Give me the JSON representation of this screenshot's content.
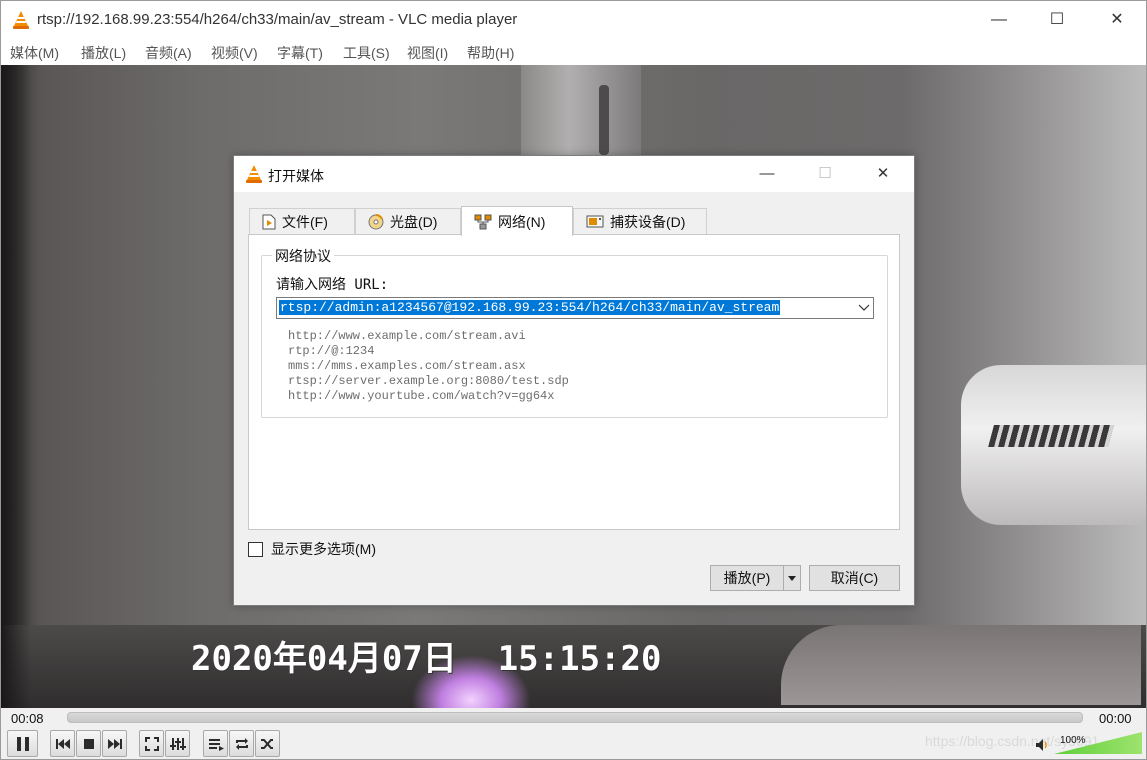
{
  "window": {
    "title": "rtsp://192.168.99.23:554/h264/ch33/main/av_stream - VLC media player",
    "controls": {
      "minimize": "—",
      "maximize": "☐",
      "close": "✕"
    }
  },
  "menu": [
    {
      "label": "媒体(M)"
    },
    {
      "label": "播放(L)"
    },
    {
      "label": "音频(A)"
    },
    {
      "label": "视频(V)"
    },
    {
      "label": "字幕(T)"
    },
    {
      "label": "工具(S)"
    },
    {
      "label": "视图(I)"
    },
    {
      "label": "帮助(H)"
    }
  ],
  "video": {
    "timestamp": "2020年04月07日  15:15:20"
  },
  "dialog": {
    "title": "打开媒体",
    "controls": {
      "minimize": "—",
      "maximize": "☐",
      "close": "✕"
    },
    "tabs": [
      {
        "label": "文件(F)",
        "icon": "file-play-icon"
      },
      {
        "label": "光盘(D)",
        "icon": "disc-icon"
      },
      {
        "label": "网络(N)",
        "icon": "network-icon",
        "active": true
      },
      {
        "label": "捕获设备(D)",
        "icon": "capture-device-icon"
      }
    ],
    "group_title": "网络协议",
    "url_label": "请输入网络 URL:",
    "url_value": "rtsp://admin:a1234567@192.168.99.23:554/h264/ch33/main/av_stream",
    "examples": [
      "http://www.example.com/stream.avi",
      "rtp://@:1234",
      "mms://mms.examples.com/stream.asx",
      "rtsp://server.example.org:8080/test.sdp",
      "http://www.yourtube.com/watch?v=gg64x"
    ],
    "more_options": "显示更多选项(M)",
    "more_options_checked": false,
    "play_button": "播放(P)",
    "cancel_button": "取消(C)"
  },
  "player": {
    "elapsed": "00:08",
    "total": "00:00",
    "progress": 0,
    "volume_label": "100%",
    "volume_level": 1.0,
    "watermark": "https://blog.csdn.net/sy9091"
  },
  "colors": {
    "selection": "#0078d7",
    "volume": "#5fcf3a"
  }
}
